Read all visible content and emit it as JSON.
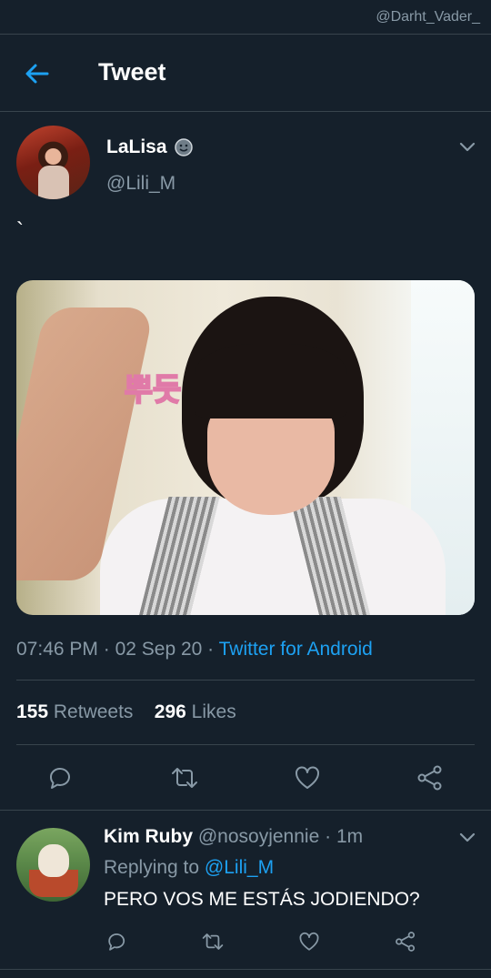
{
  "watermark": "@Darht_Vader_",
  "header": {
    "title": "Tweet"
  },
  "tweet": {
    "author_name": "LaLisa",
    "author_handle": "@Lili_M",
    "text": "`",
    "image_sticker_text": "뿌듯",
    "time": "07:46 PM",
    "date": "02 Sep 20",
    "source": "Twitter for Android",
    "retweets_count": "155",
    "retweets_label": "Retweets",
    "likes_count": "296",
    "likes_label": "Likes"
  },
  "reply": {
    "author_name": "Kim Ruby",
    "author_handle": "@nosoyjennie",
    "time_ago": "1m",
    "replying_to_label": "Replying to",
    "replying_to_handle": "@Lili_M",
    "text": "PERO VOS ME ESTÁS JODIENDO?"
  },
  "colors": {
    "background": "#15202b",
    "divider": "#38444d",
    "muted_text": "#8899a6",
    "accent": "#1da1f2"
  },
  "icons": [
    "back-arrow-icon",
    "chevron-down-icon",
    "reply-icon",
    "retweet-icon",
    "like-icon",
    "share-icon"
  ]
}
